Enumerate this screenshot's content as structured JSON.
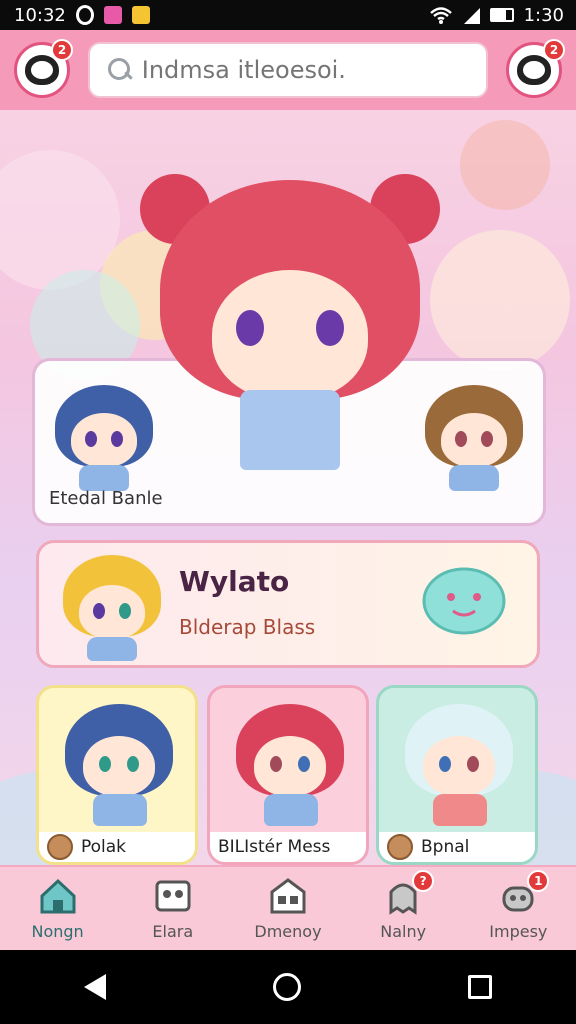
{
  "status_bar": {
    "time_left": "10:32",
    "time_right": "1:30",
    "icons": [
      "circle-icon",
      "pink-app-icon",
      "yellow-app-icon",
      "wifi-icon",
      "signal-icon",
      "battery-icon"
    ]
  },
  "header": {
    "left_badge": "2",
    "right_badge": "2",
    "search": {
      "placeholder": "Indmsa itleoesoi."
    }
  },
  "featured_card": {
    "label": "Etedal Banle"
  },
  "banner": {
    "title": "Wylato",
    "subtitle": "Blderap Blass"
  },
  "mini_cards": [
    {
      "label": "Polak"
    },
    {
      "label": "BILIstér Mess"
    },
    {
      "label": "Bpnal"
    }
  ],
  "bottom_nav": {
    "items": [
      {
        "label": "Nongn",
        "icon": "home-icon",
        "active": true
      },
      {
        "label": "Elara",
        "icon": "gallery-icon",
        "active": false
      },
      {
        "label": "Dmenoy",
        "icon": "store-icon",
        "active": false
      },
      {
        "label": "Nalny",
        "icon": "ghost-icon",
        "badge": "?"
      },
      {
        "label": "Impesy",
        "icon": "robot-icon",
        "badge": "1"
      }
    ]
  },
  "colors": {
    "header": "#f59ab8",
    "accent": "#e2537f",
    "badge": "#e23a3a",
    "nav_bg": "#f9c9d8"
  }
}
